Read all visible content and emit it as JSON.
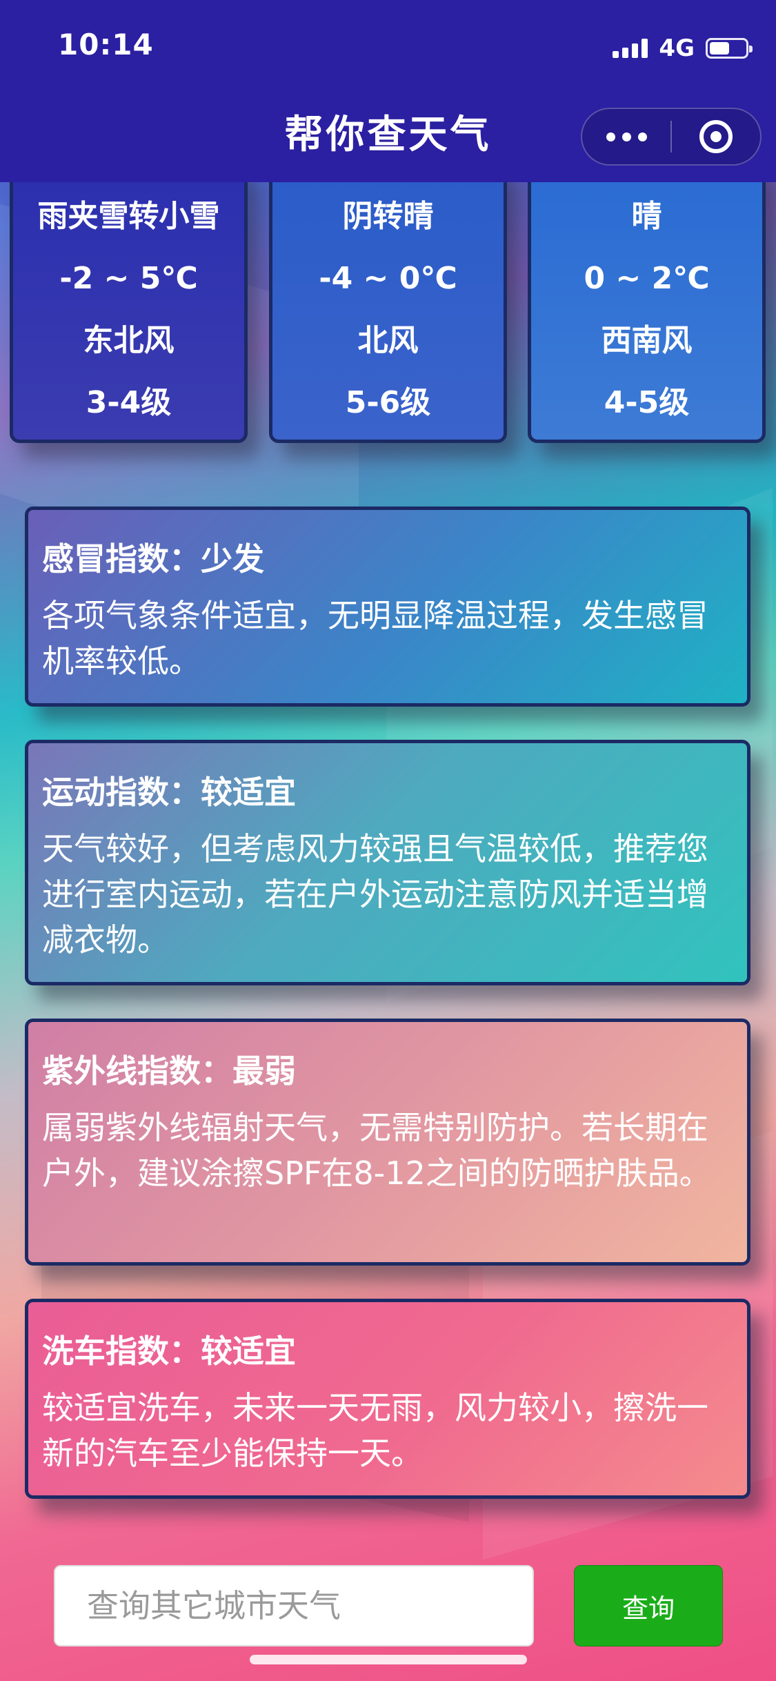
{
  "status_bar": {
    "time": "10:14",
    "network": "4G",
    "battery_level": 0.55
  },
  "nav": {
    "title": "帮你查天气"
  },
  "forecast": [
    {
      "weather": "雨夹雪转小雪",
      "temp": "-2 ~ 5℃",
      "wind_dir": "东北风",
      "wind_level": "3-4级"
    },
    {
      "weather": "阴转晴",
      "temp": "-4 ~ 0℃",
      "wind_dir": "北风",
      "wind_level": "5-6级"
    },
    {
      "weather": "晴",
      "temp": "0 ~ 2℃",
      "wind_dir": "西南风",
      "wind_level": "4-5级"
    }
  ],
  "indices": [
    {
      "title": "感冒指数：少发",
      "desc": "各项气象条件适宜，无明显降温过程，发生感冒机率较低。"
    },
    {
      "title": "运动指数：较适宜",
      "desc": "天气较好，但考虑风力较强且气温较低，推荐您进行室内运动，若在户外运动注意防风并适当增减衣物。"
    },
    {
      "title": "紫外线指数：最弱",
      "desc": "属弱紫外线辐射天气，无需特别防护。若长期在户外，建议涂擦SPF在8-12之间的防晒护肤品。"
    },
    {
      "title": "洗车指数：较适宜",
      "desc": "较适宜洗车，未来一天无雨，风力较小，擦洗一新的汽车至少能保持一天。"
    }
  ],
  "search": {
    "placeholder": "查询其它城市天气",
    "value": "",
    "button_label": "查询"
  },
  "colors": {
    "nav_bg": "#2b1fa2",
    "button_green": "#1aad19",
    "card_border": "#1b2a64"
  }
}
